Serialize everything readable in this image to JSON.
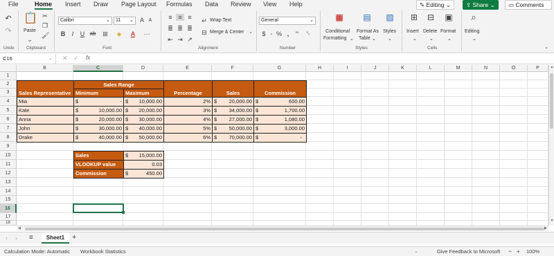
{
  "menu": {
    "items": [
      "File",
      "Home",
      "Insert",
      "Draw",
      "Page Layout",
      "Formulas",
      "Data",
      "Review",
      "View",
      "Help"
    ],
    "active": "Home",
    "editing": "Editing",
    "share": "Share",
    "comments": "Comments"
  },
  "ribbon": {
    "undo_group": "Undo",
    "clipboard": {
      "paste": "Paste",
      "label": "Clipboard"
    },
    "font": {
      "name": "Calibri",
      "size": "11",
      "bold": "B",
      "italic": "I",
      "underline": "U",
      "strike": "ab",
      "label": "Font"
    },
    "alignment": {
      "wrap": "Wrap Text",
      "merge": "Merge & Center",
      "label": "Alignment"
    },
    "number": {
      "format": "General",
      "label": "Number"
    },
    "styles": {
      "conditional_1": "Conditional",
      "conditional_2": "Formatting",
      "format_as_1": "Format As",
      "format_as_2": "Table",
      "styles": "Styles",
      "label": "Styles"
    },
    "cells": {
      "insert": "Insert",
      "delete": "Delete",
      "format": "Format",
      "label": "Cells"
    },
    "editing": {
      "label": "Editing"
    }
  },
  "formula_bar": {
    "name_box": "C16",
    "fx": "fx",
    "value": ""
  },
  "grid": {
    "columns": [
      "B",
      "C",
      "D",
      "E",
      "F",
      "G",
      "H",
      "I",
      "J",
      "K",
      "L",
      "M",
      "N",
      "O",
      "P"
    ],
    "selected_column": "C",
    "rows": [
      "1",
      "2",
      "3",
      "4",
      "5",
      "6",
      "7",
      "8",
      "9",
      "10",
      "11",
      "12",
      "13",
      "14",
      "15",
      "16",
      "17",
      "18"
    ],
    "selected_row": "16"
  },
  "table": {
    "headers": {
      "rep": "Sales Representative",
      "range": "Sales Range",
      "min": "Minimum",
      "max": "Maximum",
      "pct": "Percentage",
      "sales": "Sales",
      "commission": "Commission"
    },
    "rows": [
      {
        "name": "Mia",
        "min": "-",
        "max": "10,000.00",
        "pct": "2%",
        "sales": "20,000.00",
        "comm": "600.00"
      },
      {
        "name": "Kate",
        "min": "10,000.00",
        "max": "20,000.00",
        "pct": "3%",
        "sales": "34,000.00",
        "comm": "1,700.00"
      },
      {
        "name": "Anna",
        "min": "20,000.00",
        "max": "30,000.00",
        "pct": "4%",
        "sales": "27,000.00",
        "comm": "1,080.00"
      },
      {
        "name": "John",
        "min": "30,000.00",
        "max": "40,000.00",
        "pct": "5%",
        "sales": "50,000.00",
        "comm": "3,000.00"
      },
      {
        "name": "Drake",
        "min": "40,000.00",
        "max": "50,000.00",
        "pct": "6%",
        "sales": "70,000.00",
        "comm": "-"
      }
    ],
    "currency": "$"
  },
  "lookup": {
    "sales_label": "Sales",
    "sales_value": "15,000.00",
    "vlookup_label": "VLOOKUP value",
    "vlookup_value": "0.03",
    "commission_label": "Commission",
    "commission_value": "450.00"
  },
  "sheet": {
    "tab": "Sheet1",
    "add": "+"
  },
  "status": {
    "calc": "Calculation Mode: Automatic",
    "stats": "Workbook Statistics",
    "feedback": "Give Feedback to Microsoft",
    "minus": "−",
    "plus": "+",
    "zoom": "100%"
  },
  "colors": {
    "header_fill": "#c55a11",
    "row_fill": "#fbe5d6",
    "accent": "#217346"
  }
}
